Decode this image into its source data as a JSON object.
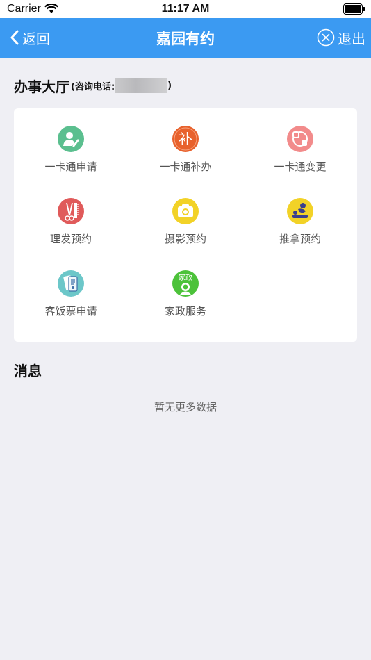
{
  "status_bar": {
    "carrier": "Carrier",
    "time": "11:17 AM"
  },
  "navbar": {
    "back_label": "返回",
    "title": "嘉园有约",
    "exit_label": "退出"
  },
  "hall": {
    "title": "办事大厅",
    "phone_prefix": "(咨询电话:",
    "phone_suffix": ")"
  },
  "services": [
    {
      "label": "一卡通申请",
      "icon": "card-apply-icon",
      "color": "#5bbf8f"
    },
    {
      "label": "一卡通补办",
      "icon": "card-reissue-icon",
      "color": "#e8612c"
    },
    {
      "label": "一卡通变更",
      "icon": "card-change-icon",
      "color": "#f28b8b"
    },
    {
      "label": "理发预约",
      "icon": "haircut-icon",
      "color": "#e05a5a"
    },
    {
      "label": "摄影预约",
      "icon": "camera-icon",
      "color": "#f2d227"
    },
    {
      "label": "推拿预约",
      "icon": "massage-icon",
      "color": "#f2d227"
    },
    {
      "label": "客饭票申请",
      "icon": "meal-ticket-icon",
      "color": "#6cc7c9"
    },
    {
      "label": "家政服务",
      "icon": "housekeeping-icon",
      "color": "#4cc23a",
      "icon_text": "家政"
    }
  ],
  "messages": {
    "title": "消息",
    "empty_text": "暂无更多数据"
  }
}
